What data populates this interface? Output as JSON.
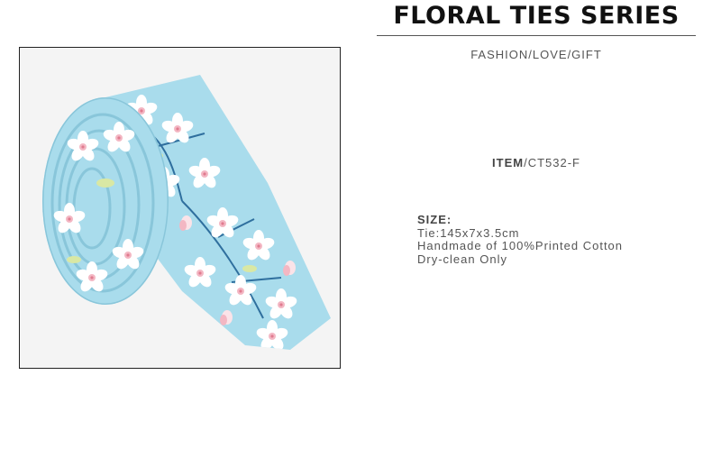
{
  "header": {
    "title": "FLORAL TIES SERIES",
    "subtitle": "FASHION/LOVE/GIFT"
  },
  "product": {
    "item_label": "ITEM",
    "item_code": "/CT532-F",
    "size_label": "SIZE:",
    "size_value": "Tie:145x7x3.5cm",
    "material": "Handmade of 100%Printed Cotton",
    "care": "Dry-clean Only"
  },
  "image": {
    "subject": "rolled-floral-tie-photo",
    "colors": {
      "fabric": "#a9dcec",
      "petal": "#ffffff",
      "blush": "#f3b7c3",
      "leaf": "#d9e8a4",
      "stem": "#2f6f9e"
    }
  }
}
